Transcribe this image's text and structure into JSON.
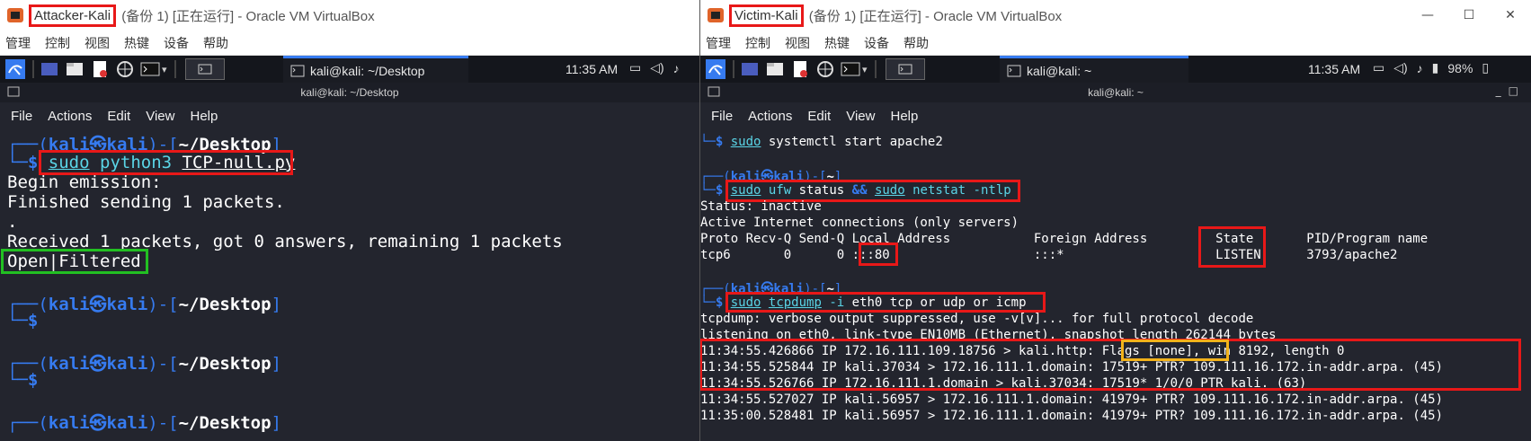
{
  "left": {
    "vbox_title_name": "Attacker-Kali",
    "vbox_title_rest": " (备份 1) [正在运行] - Oracle VM VirtualBox",
    "vbox_menu": [
      "管理",
      "控制",
      "视图",
      "热键",
      "设备",
      "帮助"
    ],
    "task_label": "kali@kali: ~/Desktop",
    "clock": "11:35 AM",
    "terminal_title": "kali@kali: ~/Desktop",
    "terminal_menu": [
      "File",
      "Actions",
      "Edit",
      "View",
      "Help"
    ],
    "prompt_open": "┌──(",
    "prompt_user": "kali㉿kali",
    "prompt_mid": ")-[",
    "prompt_dir": "~/Desktop",
    "prompt_close": "]",
    "prompt_arrow": "└─",
    "prompt_dollar": "$",
    "cmd_sudo": "sudo",
    "cmd_python": "python3",
    "cmd_script": "TCP-null.py",
    "out_begin": "Begin emission:",
    "out_finished": "Finished sending 1 packets.",
    "out_dot": ".",
    "out_received": "Received 1 packets, got 0 answers, remaining 1 packets",
    "out_result": "Open|Filtered"
  },
  "right": {
    "vbox_title_name": "Victim-Kali",
    "vbox_title_rest": " (备份 1) [正在运行] - Oracle VM VirtualBox",
    "vbox_menu": [
      "管理",
      "控制",
      "视图",
      "热键",
      "设备",
      "帮助"
    ],
    "task_label": "kali@kali: ~",
    "clock": "11:35 AM",
    "battery": "98%",
    "terminal_title": "kali@kali: ~",
    "terminal_menu": [
      "File",
      "Actions",
      "Edit",
      "View",
      "Help"
    ],
    "line1_sudo": "sudo",
    "line1_rest": " systemctl start apache2",
    "prompt_open": "┌──(",
    "prompt_user": "kali㉿kali",
    "prompt_mid": ")-[",
    "prompt_dir": "~",
    "prompt_close": "]",
    "prompt_arrow": "└─",
    "prompt_dollar": "$",
    "cmd2_sudo": "sudo",
    "cmd2_ufw": "ufw",
    "cmd2_status": "status",
    "cmd2_and": "&&",
    "cmd2_sudo2": "sudo",
    "cmd2_netstat": "netstat",
    "cmd2_flag": "-ntlp",
    "status": "Status: inactive",
    "active_conn": "Active Internet connections (only servers)",
    "netstat_header": "Proto Recv-Q Send-Q Local Address           Foreign Address         State       PID/Program name",
    "netstat_row": "tcp6       0      0 :::80                   :::*                    LISTEN      3793/apache2",
    "cmd3_sudo": "sudo",
    "cmd3_tcpdump": "tcpdump",
    "cmd3_flag": "-i",
    "cmd3_rest": "eth0 tcp or udp or icmp",
    "tcpdump_info1": "tcpdump: verbose output suppressed, use -v[v]... for full protocol decode",
    "tcpdump_info2": "listening on eth0, link-type EN10MB (Ethernet), snapshot length 262144 bytes",
    "packets": [
      "11:34:55.426866 IP 172.16.111.109.18756 > kali.http: Flags [none], win 8192, length 0",
      "11:34:55.525844 IP kali.37034 > 172.16.111.1.domain: 17519+ PTR? 109.111.16.172.in-addr.arpa. (45)",
      "11:34:55.526766 IP 172.16.111.1.domain > kali.37034: 17519* 1/0/0 PTR kali. (63)",
      "11:34:55.527027 IP kali.56957 > 172.16.111.1.domain: 41979+ PTR? 109.111.16.172.in-addr.arpa. (45)",
      "11:35:00.528481 IP kali.56957 > 172.16.111.1.domain: 41979+ PTR? 109.111.16.172.in-addr.arpa. (45)"
    ]
  },
  "colors": {
    "highlight_red": "#e81818",
    "highlight_green": "#22c022",
    "highlight_orange": "#f2b21a",
    "kali_blue": "#367bf0",
    "command_cyan": "#5ad4e6"
  }
}
